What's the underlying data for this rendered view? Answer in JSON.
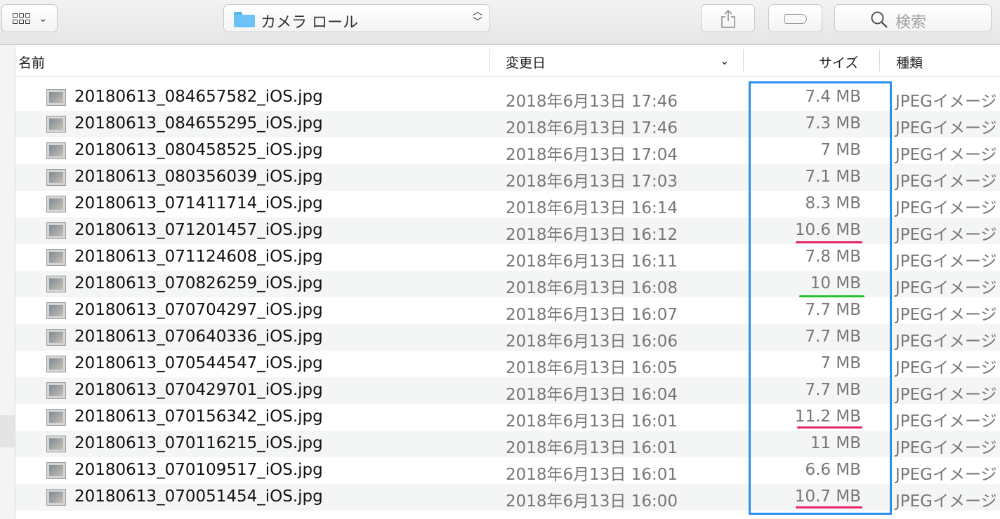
{
  "toolbar": {
    "path_label": "カメラ ロール",
    "search_placeholder": "検索",
    "icons": [
      "view-grid-icon",
      "chevron-down-icon",
      "folder-icon",
      "updown-chevron-icon",
      "share-icon",
      "tag-icon",
      "search-icon"
    ]
  },
  "header": {
    "name": "名前",
    "date": "変更日",
    "size": "サイズ",
    "kind": "種類"
  },
  "rows": [
    {
      "name": "20180613_084657582_iOS.jpg",
      "date": "2018年6月13日 17:46",
      "size": "7.4 MB",
      "kind": "JPEGイメージ"
    },
    {
      "name": "20180613_084655295_iOS.jpg",
      "date": "2018年6月13日 17:46",
      "size": "7.3 MB",
      "kind": "JPEGイメージ"
    },
    {
      "name": "20180613_080458525_iOS.jpg",
      "date": "2018年6月13日 17:04",
      "size": "7 MB",
      "kind": "JPEGイメージ"
    },
    {
      "name": "20180613_080356039_iOS.jpg",
      "date": "2018年6月13日 17:03",
      "size": "7.1 MB",
      "kind": "JPEGイメージ"
    },
    {
      "name": "20180613_071411714_iOS.jpg",
      "date": "2018年6月13日 16:14",
      "size": "8.3 MB",
      "kind": "JPEGイメージ"
    },
    {
      "name": "20180613_071201457_iOS.jpg",
      "date": "2018年6月13日 16:12",
      "size": "10.6 MB",
      "kind": "JPEGイメージ"
    },
    {
      "name": "20180613_071124608_iOS.jpg",
      "date": "2018年6月13日 16:11",
      "size": "7.8 MB",
      "kind": "JPEGイメージ"
    },
    {
      "name": "20180613_070826259_iOS.jpg",
      "date": "2018年6月13日 16:08",
      "size": "10 MB",
      "kind": "JPEGイメージ"
    },
    {
      "name": "20180613_070704297_iOS.jpg",
      "date": "2018年6月13日 16:07",
      "size": "7.7 MB",
      "kind": "JPEGイメージ"
    },
    {
      "name": "20180613_070640336_iOS.jpg",
      "date": "2018年6月13日 16:06",
      "size": "7.7 MB",
      "kind": "JPEGイメージ"
    },
    {
      "name": "20180613_070544547_iOS.jpg",
      "date": "2018年6月13日 16:05",
      "size": "7 MB",
      "kind": "JPEGイメージ"
    },
    {
      "name": "20180613_070429701_iOS.jpg",
      "date": "2018年6月13日 16:04",
      "size": "7.7 MB",
      "kind": "JPEGイメージ"
    },
    {
      "name": "20180613_070156342_iOS.jpg",
      "date": "2018年6月13日 16:01",
      "size": "11.2 MB",
      "kind": "JPEGイメージ"
    },
    {
      "name": "20180613_070116215_iOS.jpg",
      "date": "2018年6月13日 16:01",
      "size": "11 MB",
      "kind": "JPEGイメージ"
    },
    {
      "name": "20180613_070109517_iOS.jpg",
      "date": "2018年6月13日 16:01",
      "size": "6.6 MB",
      "kind": "JPEGイメージ"
    },
    {
      "name": "20180613_070051454_iOS.jpg",
      "date": "2018年6月13日 16:00",
      "size": "10.7 MB",
      "kind": "JPEGイメージ"
    }
  ],
  "annotations": {
    "box_color": "#2b8ff0",
    "underline_pink": "#e8246d",
    "underline_green": "#26c22b",
    "underlined_sizes": [
      {
        "size": "10.6 MB",
        "color": "pink"
      },
      {
        "size": "10 MB",
        "color": "green"
      },
      {
        "size": "11.2 MB",
        "color": "pink"
      },
      {
        "size": "10.7 MB",
        "color": "pink"
      }
    ]
  }
}
